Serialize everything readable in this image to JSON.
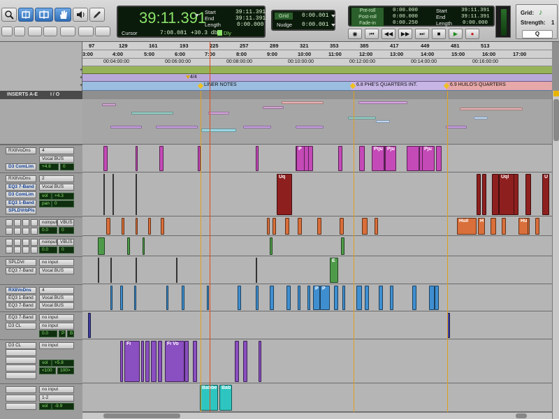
{
  "colors": {
    "lcd_green": "#7fe05d",
    "playhead": "#e34a1a",
    "marker_line": "#e0a020",
    "purple_clip": "#8a4fc0",
    "magenta_clip": "#c44ab7",
    "red_clip": "#8e1f1f",
    "orange_clip": "#d96f3a",
    "green_clip": "#4f9a4a",
    "blue_clip": "#3f8fd0",
    "cyan_clip": "#2ec5c0"
  },
  "tools": {
    "zoom_icon": "magnifier-icon",
    "trim_icon": "trim-icon",
    "select_icon": "selector-icon",
    "grab_icon": "hand-icon",
    "speaker_icon": "speaker-icon",
    "pencil_icon": "pencil-icon"
  },
  "counter": {
    "main": "39:11.391",
    "start_label": "Start",
    "start": "39:11.391",
    "end_label": "End",
    "end": "39:11.391",
    "length_label": "Length",
    "length": "0:00.000",
    "cursor_label": "Cursor",
    "cursor": "7:08.081",
    "db": "+30.3 db",
    "dly_label": "Dly"
  },
  "grid": {
    "grid_label": "Grid",
    "grid_value": "0:00.001",
    "nudge_label": "Nudge",
    "nudge_value": "0:00.001"
  },
  "transport": {
    "preroll_label": "Pre-roll",
    "preroll": "0:00.000",
    "postroll_label": "Post-roll",
    "postroll": "0:00.000",
    "fadein_label": "Fade-in",
    "fadein": "0:00.250",
    "start_label": "Start",
    "start": "39:11.391",
    "end_label": "End",
    "end": "39:11.391",
    "length_label": "Length",
    "length": "0:00.000"
  },
  "snap": {
    "grid_label": "Grid:",
    "strength_label": "Strength:",
    "strength": "1",
    "search_label": "Q"
  },
  "bars_ruler": [
    "97",
    "129",
    "161",
    "193",
    "225",
    "257",
    "289",
    "321",
    "353",
    "385",
    "417",
    "449",
    "481",
    "513"
  ],
  "min_ruler": [
    "3:00",
    "4:00",
    "5:00",
    "6:00",
    "7:00",
    "8:00",
    "9:00",
    "10:00",
    "11:00",
    "12:00",
    "13:00",
    "14:00",
    "15:00",
    "16:00",
    "17:00"
  ],
  "tc_ruler": [
    "00:04:00:00",
    "00:06:00:00",
    "00:08:00:00",
    "00:10:00:00",
    "00:12:00:00",
    "00:14:00:00",
    "00:16:00:00"
  ],
  "meter": "4/4",
  "markers": [
    "LINER NOTES",
    "6.8 PHE'S QUARTERS INT.",
    "6.9 HUILO'S QUARTERS"
  ],
  "header": {
    "inserts": "INSERTS A-E",
    "io": "I / O"
  },
  "tracks": [
    {
      "inserts": [
        "RX8VoDns"
      ],
      "io": [
        "4",
        "Vocal BUS"
      ],
      "plugin2": "D3 ComLim",
      "vol": "+4.6",
      "pan": "0",
      "clips": [
        "P",
        "Piju",
        "Pju",
        "Pju"
      ]
    },
    {
      "inserts": [
        "RX8VoDns",
        "EQ3 7-Band",
        "D3 ComLim",
        "EQ3 1-Band",
        "SPLDVrbPls"
      ],
      "io": [
        "2",
        "Vocal BUS"
      ],
      "vol_label": "vol",
      "vol": "+4.3",
      "pan_label": "pan",
      "pan": "0",
      "clips": [
        "Uq",
        "Uql",
        "U"
      ]
    },
    {
      "io": [
        "noinput",
        "VBUS"
      ],
      "vol": "0.0",
      "pan": "0",
      "clips": [
        "Huil",
        "H",
        "Hu"
      ]
    },
    {
      "io": [
        "noinput",
        "VBUS"
      ],
      "vol": "0.0",
      "pan": "0"
    },
    {
      "inserts": [
        "SPLDVr",
        "EQ3 7-Band"
      ],
      "io": [
        "no input",
        "Vocal BUS"
      ],
      "clips": [
        "E"
      ]
    },
    {
      "inserts": [
        "RX8VoDns",
        "EQ3 1-Band",
        "EQ3 7-Band"
      ],
      "io": [
        "4",
        "Vocal BUS",
        "Vocal BUS"
      ],
      "clips": [
        "P",
        "P"
      ]
    },
    {
      "inserts": [
        "EQ3 7-Band",
        "D3 CL"
      ],
      "io": [
        "no input",
        "no input"
      ],
      "vol": "0.0",
      "pan_a": "P",
      "pan_b": "B"
    },
    {
      "inserts": [
        "D3 CL"
      ],
      "io": [
        "no input"
      ],
      "vol_label": "vol",
      "vol": "+5.8",
      "pan_l": "<100",
      "pan_r": "100>",
      "clips": [
        "Fi",
        "Fi Vo"
      ]
    },
    {
      "io": [
        "no input",
        "1-2"
      ],
      "vol_label": "vol",
      "vol": "-9.9",
      "clips": [
        "Babbe",
        "Bab"
      ]
    }
  ]
}
